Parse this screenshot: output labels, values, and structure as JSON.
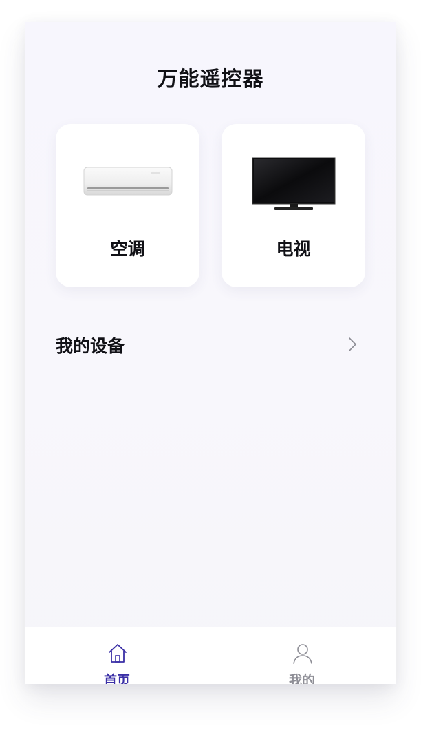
{
  "header": {
    "title": "万能遥控器"
  },
  "devices": [
    {
      "label": "空调",
      "icon": "air-conditioner-image"
    },
    {
      "label": "电视",
      "icon": "television-image"
    }
  ],
  "my_devices": {
    "label": "我的设备",
    "icon": "chevron-right-icon"
  },
  "tabbar": {
    "active_color": "#3a2fa6",
    "inactive_color": "#8e8e96",
    "tabs": [
      {
        "label": "首页",
        "icon": "home-icon",
        "active": true
      },
      {
        "label": "我的",
        "icon": "user-icon",
        "active": false
      }
    ]
  }
}
